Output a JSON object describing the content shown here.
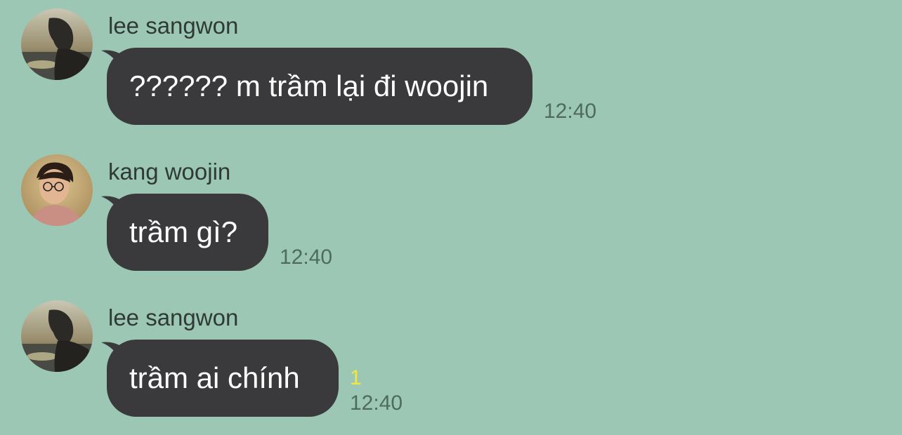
{
  "colors": {
    "background": "#9cc7b4",
    "bubble": "#3a3a3c",
    "bubble_text": "#ffffff",
    "sender_text": "#2f3a36",
    "time_text": "#4f6a60",
    "unread_count": "#f5e83a"
  },
  "messages": [
    {
      "sender": "lee sangwon",
      "avatar": "profile-photo-lee-sangwon",
      "text": "?????? m trầm lại đi woojin",
      "time": "12:40",
      "unread": ""
    },
    {
      "sender": "kang woojin",
      "avatar": "profile-photo-kang-woojin",
      "text": "trầm gì?",
      "time": "12:40",
      "unread": ""
    },
    {
      "sender": "lee sangwon",
      "avatar": "profile-photo-lee-sangwon",
      "text": "trầm ai chính",
      "time": "12:40",
      "unread": "1"
    }
  ]
}
